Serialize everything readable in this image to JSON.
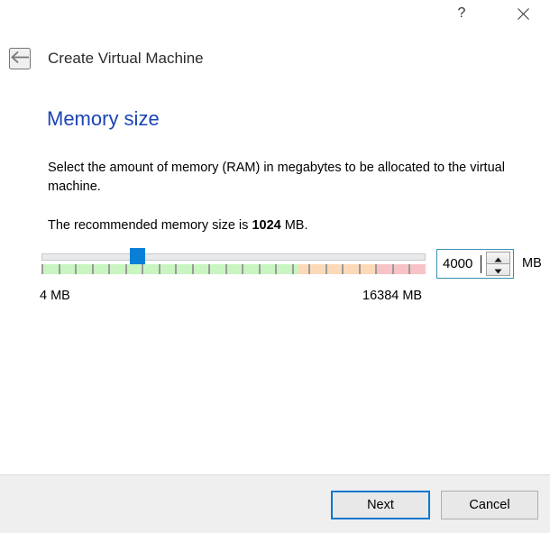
{
  "window": {
    "help_icon": "question-mark-icon",
    "close_icon": "close-icon",
    "help_label": "?"
  },
  "header": {
    "back_icon": "arrow-left-icon",
    "title": "Create Virtual Machine"
  },
  "page": {
    "heading": "Memory size",
    "description": "Select the amount of memory (RAM) in megabytes to be allocated to the virtual machine.",
    "recommend_prefix": "The recommended memory size is ",
    "recommend_value": "1024",
    "recommend_suffix": " MB.",
    "heading_color": "#1a45b5"
  },
  "slider": {
    "min_label": "4 MB",
    "max_label": "16384 MB",
    "min_value": 4,
    "max_value": 16384,
    "current_value": 4000,
    "handle_position_percent": 23,
    "handle_color": "#0a7fd6",
    "zones": [
      {
        "name": "safe-zone",
        "color": "#c9f5c1",
        "start_percent": 0,
        "end_percent": 67
      },
      {
        "name": "warning-zone",
        "color": "#fcd9b8",
        "start_percent": 67,
        "end_percent": 87
      },
      {
        "name": "danger-zone",
        "color": "#f7c3c7",
        "start_percent": 87,
        "end_percent": 100
      }
    ],
    "tick_count": 23
  },
  "spinbox": {
    "value": "4000",
    "unit": "MB",
    "up_icon": "chevron-up-icon",
    "down_icon": "chevron-down-icon",
    "focus_border_color": "#3a8fb5"
  },
  "footer": {
    "next_label": "Next",
    "cancel_label": "Cancel",
    "accent_color": "#0b78d0"
  }
}
